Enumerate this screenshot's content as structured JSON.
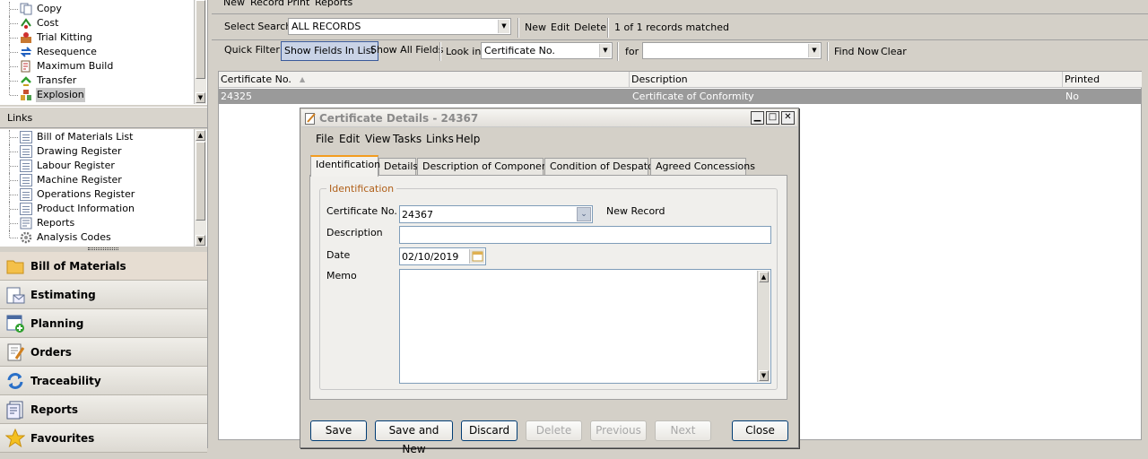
{
  "nav_tree": {
    "items": [
      {
        "label": "Copy",
        "icon": "copy-icon"
      },
      {
        "label": "Cost",
        "icon": "cost-icon"
      },
      {
        "label": "Trial Kitting",
        "icon": "trial-kitting-icon"
      },
      {
        "label": "Resequence",
        "icon": "resequence-icon"
      },
      {
        "label": "Maximum Build",
        "icon": "maximum-build-icon"
      },
      {
        "label": "Transfer",
        "icon": "transfer-icon"
      },
      {
        "label": "Explosion",
        "icon": "explosion-icon"
      }
    ]
  },
  "links": {
    "header": "Links",
    "items": [
      {
        "label": "Bill of Materials List"
      },
      {
        "label": "Drawing Register"
      },
      {
        "label": "Labour Register"
      },
      {
        "label": "Machine Register"
      },
      {
        "label": "Operations Register"
      },
      {
        "label": "Product Information"
      },
      {
        "label": "Reports"
      },
      {
        "label": "Analysis Codes"
      }
    ]
  },
  "nav_buttons": [
    {
      "label": "Bill of Materials"
    },
    {
      "label": "Estimating"
    },
    {
      "label": "Planning"
    },
    {
      "label": "Orders"
    },
    {
      "label": "Traceability"
    },
    {
      "label": "Reports"
    },
    {
      "label": "Favourites"
    }
  ],
  "menubar": {
    "new": "New",
    "record": "Record",
    "print": "Print",
    "reports": "Reports"
  },
  "search_bar": {
    "select_search_label": "Select Search",
    "select_search_value": "ALL RECORDS",
    "new": "New",
    "edit": "Edit",
    "delete": "Delete",
    "matched": "1 of 1 records matched"
  },
  "filter_bar": {
    "quick_filter": "Quick Filter",
    "show_fields_in_list": "Show Fields In List",
    "show_all_fields": "Show All Fields",
    "look_in_label": "Look in",
    "look_in_value": "Certificate No.",
    "for_label": "for",
    "for_value": "",
    "find_now": "Find Now",
    "clear": "Clear"
  },
  "grid": {
    "columns": [
      "Certificate No.",
      "Description",
      "Printed"
    ],
    "rows": [
      [
        "24325",
        "Certificate of Conformity",
        "No"
      ]
    ]
  },
  "dialog": {
    "title": "Certificate Details - 24367",
    "menu": [
      "File",
      "Edit",
      "View",
      "Tasks",
      "Links",
      "Help"
    ],
    "tabs": [
      "Identification",
      "Details",
      "Description of Components",
      "Condition of Despatch",
      "Agreed Concessions"
    ],
    "group_title": "Identification",
    "certificate_label": "Certificate No.",
    "certificate_value": "24367",
    "new_record": "New Record",
    "description_label": "Description",
    "description_value": "",
    "date_label": "Date",
    "date_value": "02/10/2019",
    "memo_label": "Memo",
    "memo_value": "",
    "buttons": {
      "save": "Save",
      "save_and_new": "Save and New",
      "discard": "Discard",
      "delete": "Delete",
      "previous": "Previous",
      "next": "Next",
      "close": "Close"
    }
  }
}
